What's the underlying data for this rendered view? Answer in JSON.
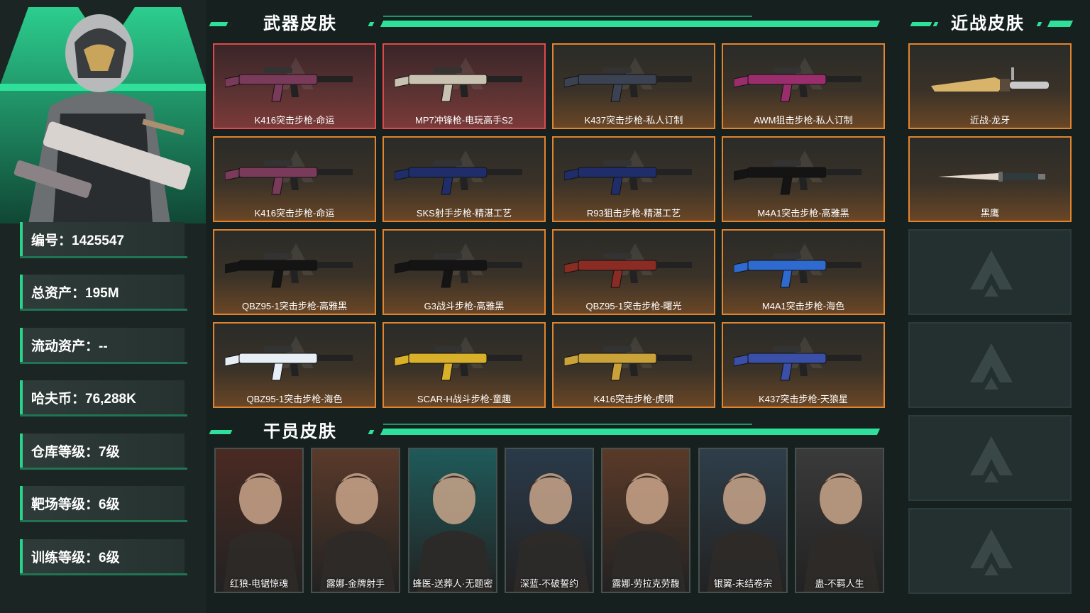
{
  "player": {
    "stats": [
      {
        "label": "编号：1425547"
      },
      {
        "label": "总资产：195M"
      },
      {
        "label": "流动资产：--"
      },
      {
        "label": "哈夫币：76,288K"
      },
      {
        "label": "仓库等级：7级"
      },
      {
        "label": "靶场等级：6级"
      },
      {
        "label": "训练等级：6级"
      }
    ]
  },
  "sections": {
    "weapons_title": "武器皮肤",
    "melee_title": "近战皮肤",
    "operators_title": "干员皮肤"
  },
  "weapons": [
    {
      "name": "K416突击步枪-命运",
      "rarity": "red",
      "color": "#7a3a5a"
    },
    {
      "name": "MP7冲锋枪-电玩高手S2",
      "rarity": "red",
      "color": "#c9c2b0"
    },
    {
      "name": "K437突击步枪-私人订制",
      "rarity": "orange",
      "color": "#3b4252"
    },
    {
      "name": "AWM狙击步枪-私人订制",
      "rarity": "orange",
      "color": "#9a2e6c"
    },
    {
      "name": "K416突击步枪-命运",
      "rarity": "orange",
      "color": "#7a3a5a"
    },
    {
      "name": "SKS射手步枪-精湛工艺",
      "rarity": "orange",
      "color": "#1f2e6a"
    },
    {
      "name": "R93狙击步枪-精湛工艺",
      "rarity": "orange",
      "color": "#1f2e6a"
    },
    {
      "name": "M4A1突击步枪-高雅黑",
      "rarity": "orange",
      "color": "#141414"
    },
    {
      "name": "QBZ95-1突击步枪-高雅黑",
      "rarity": "orange",
      "color": "#141414"
    },
    {
      "name": "G3战斗步枪-高雅黑",
      "rarity": "orange",
      "color": "#141414"
    },
    {
      "name": "QBZ95-1突击步枪-曙光",
      "rarity": "orange",
      "color": "#8a2c24"
    },
    {
      "name": "M4A1突击步枪-海色",
      "rarity": "orange",
      "color": "#2e6ad0"
    },
    {
      "name": "QBZ95-1突击步枪-海色",
      "rarity": "orange",
      "color": "#e8eef5"
    },
    {
      "name": "SCAR-H战斗步枪-童趣",
      "rarity": "orange",
      "color": "#d9b02a"
    },
    {
      "name": "K416突击步枪-虎啸",
      "rarity": "orange",
      "color": "#caa23a"
    },
    {
      "name": "K437突击步枪-天狼星",
      "rarity": "orange",
      "color": "#3a4fa8"
    }
  ],
  "melee": [
    {
      "name": "近战-龙牙"
    },
    {
      "name": "黑鹰"
    }
  ],
  "operators": [
    {
      "name": "红狼-电锯惊魂",
      "bg": "#4a2a22"
    },
    {
      "name": "露娜-金牌射手",
      "bg": "#5a3a2a"
    },
    {
      "name": "蜂医-送葬人·无题密",
      "bg": "#1f5a5a"
    },
    {
      "name": "深蓝-不破誓约",
      "bg": "#2a3a4a"
    },
    {
      "name": "露娜-劳拉克劳馥",
      "bg": "#5a3a28"
    },
    {
      "name": "银翼-未结卷宗",
      "bg": "#2e3e4a"
    },
    {
      "name": "蛊-不羁人生",
      "bg": "#3a3a3a"
    }
  ],
  "colors": {
    "accent": "#2ee09a",
    "rare_orange": "#e2832d",
    "rare_red": "#e2484b"
  }
}
